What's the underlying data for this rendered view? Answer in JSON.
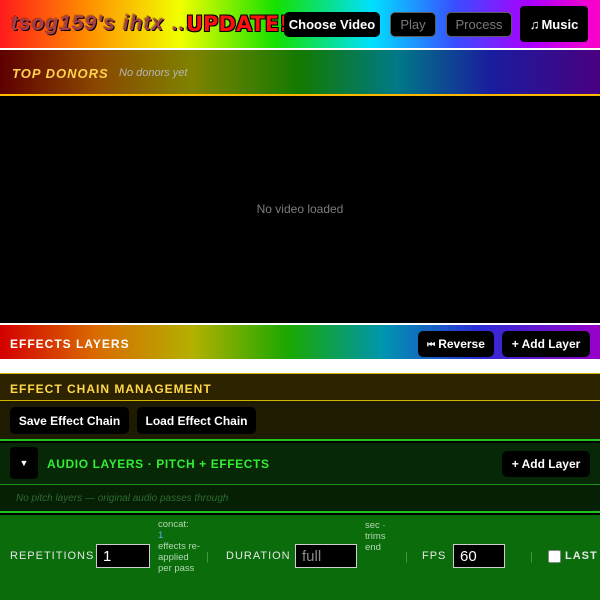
{
  "header": {
    "app_title": "tsog159's ihtx",
    "ellipsis": "...",
    "update_badge": "UPDATE!",
    "choose_video": "Choose Video",
    "play": "Play",
    "process": "Process",
    "music_icon": "♫",
    "music": "Music"
  },
  "donors": {
    "title": "TOP DONORS",
    "empty_text": "No donors yet"
  },
  "video": {
    "empty_text": "No video loaded"
  },
  "effects_layers": {
    "title": "EFFECTS LAYERS",
    "reverse_icon": "⏮",
    "reverse": "Reverse",
    "add_layer": "+ Add Layer"
  },
  "effect_chain": {
    "title": "EFFECT CHAIN MANAGEMENT",
    "save": "Save Effect Chain",
    "load": "Load Effect Chain"
  },
  "audio_layers": {
    "toggle_icon": "▼",
    "title": "AUDIO LAYERS · PITCH + EFFECTS",
    "add_layer": "+ Add Layer",
    "empty_text": "No pitch layers — original audio passes through"
  },
  "settings": {
    "repetitions_label": "REPETITIONS",
    "repetitions_value": "1",
    "repetitions_note_pre": "concat:",
    "repetitions_note_num": "1",
    "repetitions_note_post": "effects re-applied per pass",
    "separator": "|",
    "duration_label": "DURATION",
    "duration_placeholder": "full",
    "duration_note": "sec · trims end",
    "fps_label": "FPS",
    "fps_value": "60",
    "last_label": "LAST P"
  }
}
